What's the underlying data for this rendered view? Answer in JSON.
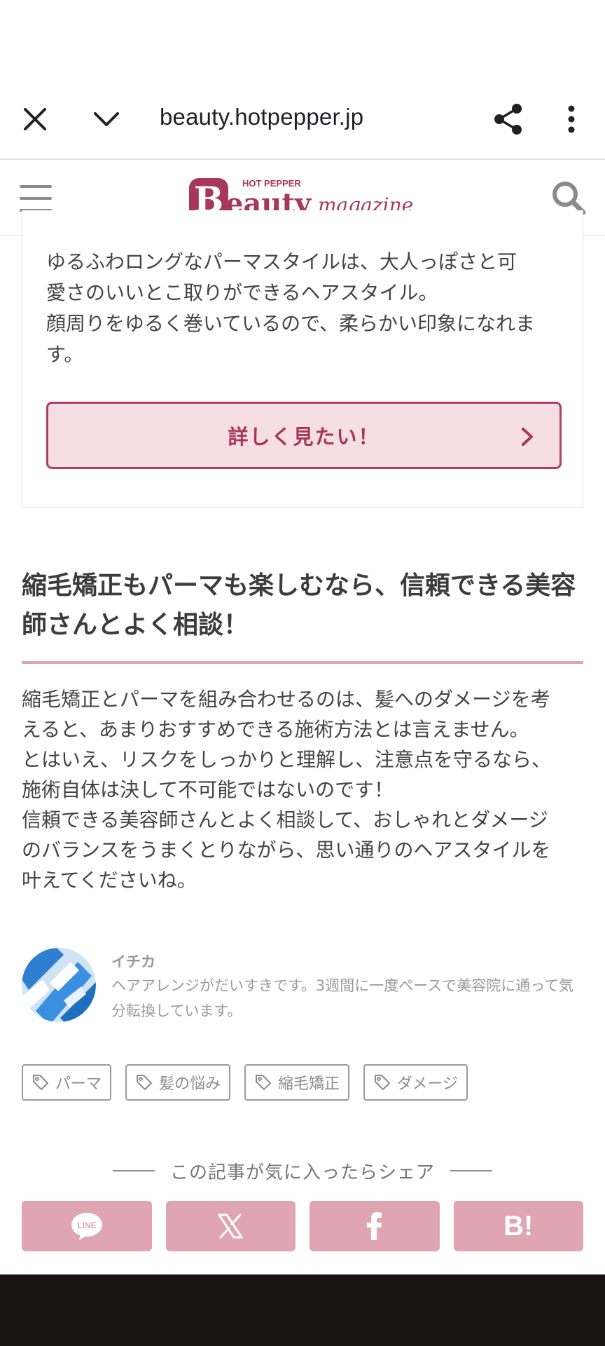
{
  "browser": {
    "url": "beauty.hotpepper.jp",
    "icons": [
      "close-icon",
      "chevron-down-icon",
      "share-icon",
      "more-vert-icon"
    ]
  },
  "site": {
    "logo_small": "HOT PEPPER",
    "logo_main_b": "B",
    "logo_main_rest": "eauty",
    "logo_script": "magazine",
    "brand_color": "#a8375e"
  },
  "card": {
    "text": "ゆるふわロングなパーマスタイルは、大人っぽさと可\n愛さのいいとこ取りができるヘアスタイル。\n顔周りをゆるく巻いているので、柔らかい印象になれま\nす。",
    "button_label": "詳しく見たい！"
  },
  "section": {
    "heading": "縮毛矯正もパーマも楽しむなら、信頼できる美容師さんとよく相談！",
    "body": "縮毛矯正とパーマを組み合わせるのは、髪へのダメージを考\nえると、あまりおすすめできる施術方法とは言えません。\nとはいえ、リスクをしっかりと理解し、注意点を守るなら、\n施術自体は決して不可能ではないのです！\n信頼できる美容師さんとよく相談して、おしゃれとダメージ\nのバランスをうまくとりながら、思い通りのヘアスタイルを\n叶えてくださいね。"
  },
  "author": {
    "name": "イチカ",
    "bio": "ヘアアレンジがだいすきです。3週間に一度ペースで美容院に通って気分転換しています。"
  },
  "tags": [
    "パーマ",
    "髪の悩み",
    "縮毛矯正",
    "ダメージ"
  ],
  "share": {
    "title": "この記事が気に入ったらシェア",
    "line_label": "LINE",
    "hatena_label": "B!",
    "button_color": "#dfa5b2"
  }
}
